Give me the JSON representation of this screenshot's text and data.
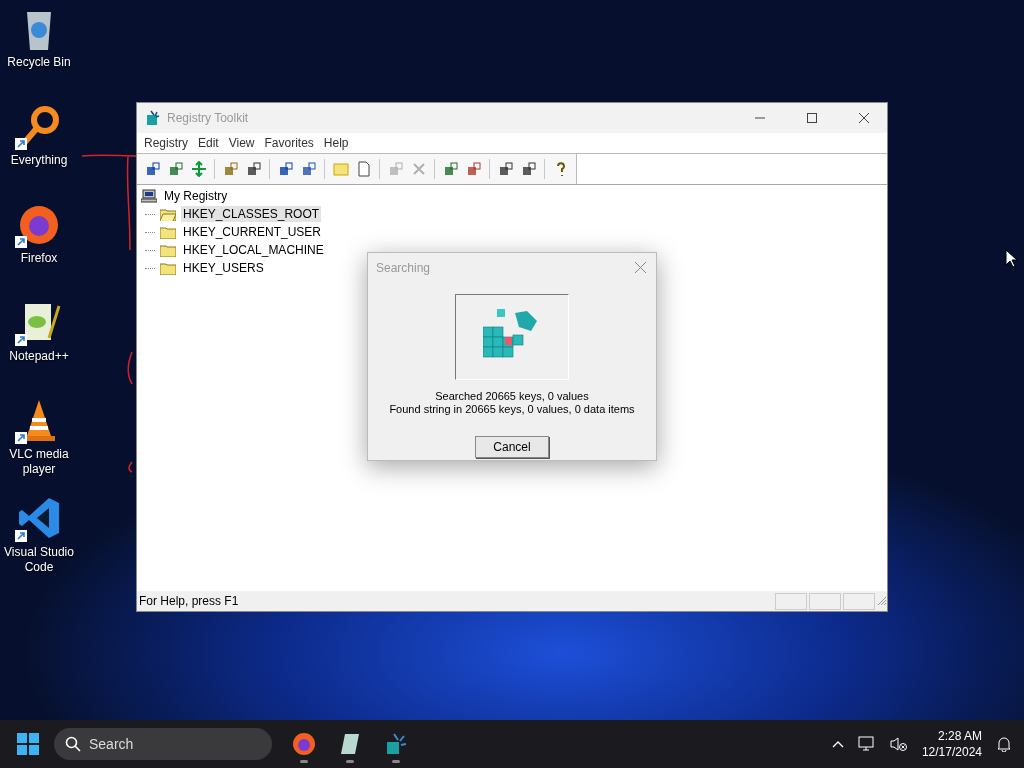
{
  "desktop_icons": [
    {
      "label": "Recycle Bin",
      "shortcut": false
    },
    {
      "label": "Everything",
      "shortcut": true
    },
    {
      "label": "Firefox",
      "shortcut": true
    },
    {
      "label": "Notepad++",
      "shortcut": true
    },
    {
      "label": "VLC media player",
      "shortcut": true
    },
    {
      "label": "Visual Studio Code",
      "shortcut": true
    }
  ],
  "window": {
    "title": "Registry Toolkit",
    "menu": [
      "Registry",
      "Edit",
      "View",
      "Favorites",
      "Help"
    ],
    "toolbar": [
      [
        {
          "disabled": false
        },
        {
          "disabled": false
        },
        {
          "disabled": false
        }
      ],
      [
        {
          "disabled": false
        },
        {
          "disabled": false
        }
      ],
      [
        {
          "disabled": false
        },
        {
          "disabled": false
        }
      ],
      [
        {
          "disabled": false
        },
        {
          "disabled": false
        }
      ],
      [
        {
          "disabled": true
        },
        {
          "disabled": true
        }
      ],
      [
        {
          "disabled": false
        },
        {
          "disabled": false
        }
      ],
      [
        {
          "disabled": false
        },
        {
          "disabled": false
        }
      ],
      [
        {
          "disabled": false
        }
      ]
    ],
    "tree": {
      "label": "My Registry",
      "children": [
        {
          "label": "HKEY_CLASSES_ROOT",
          "selected": true
        },
        {
          "label": "HKEY_CURRENT_USER",
          "selected": false
        },
        {
          "label": "HKEY_LOCAL_MACHINE",
          "selected": false
        },
        {
          "label": "HKEY_USERS",
          "selected": false
        }
      ]
    },
    "status_bar": "For Help, press F1"
  },
  "dialog": {
    "title": "Searching",
    "lines": [
      "Searched 20665 keys, 0 values",
      "Found string in 20665 keys, 0 values, 0 data items"
    ],
    "button": "Cancel"
  },
  "taskbar": {
    "search": {
      "placeholder": "Search"
    },
    "time": "2:28 AM",
    "date": "12/17/2024"
  }
}
